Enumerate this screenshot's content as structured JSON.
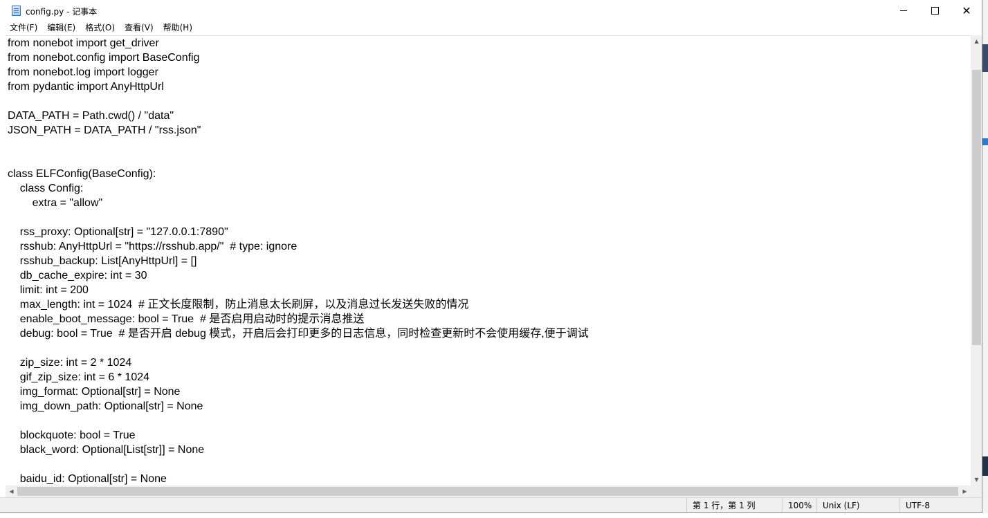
{
  "window": {
    "title": "config.py - 记事本"
  },
  "menu": [
    "文件(F)",
    "编辑(E)",
    "格式(O)",
    "查看(V)",
    "帮助(H)"
  ],
  "editor": {
    "lines": [
      "from nonebot import get_driver",
      "from nonebot.config import BaseConfig",
      "from nonebot.log import logger",
      "from pydantic import AnyHttpUrl",
      "",
      "DATA_PATH = Path.cwd() / \"data\"",
      "JSON_PATH = DATA_PATH / \"rss.json\"",
      "",
      "",
      "class ELFConfig(BaseConfig):",
      "    class Config:",
      "        extra = \"allow\"",
      "",
      "    rss_proxy: Optional[str] = \"127.0.0.1:7890\"",
      "    rsshub: AnyHttpUrl = \"https://rsshub.app/\"  # type: ignore",
      "    rsshub_backup: List[AnyHttpUrl] = []",
      "    db_cache_expire: int = 30",
      "    limit: int = 200",
      "    max_length: int = 1024  # 正文长度限制，防止消息太长刷屏，以及消息过长发送失败的情况",
      "    enable_boot_message: bool = True  # 是否启用启动时的提示消息推送",
      "    debug: bool = True  # 是否开启 debug 模式，开启后会打印更多的日志信息，同时检查更新时不会使用缓存,便于调试",
      "",
      "    zip_size: int = 2 * 1024",
      "    gif_zip_size: int = 6 * 1024",
      "    img_format: Optional[str] = None",
      "    img_down_path: Optional[str] = None",
      "",
      "    blockquote: bool = True",
      "    black_word: Optional[List[str]] = None",
      "",
      "    baidu_id: Optional[str] = None"
    ]
  },
  "status": {
    "position": "第 1 行，第 1 列",
    "zoom": "100%",
    "line_ending": "Unix (LF)",
    "encoding": "UTF-8"
  },
  "icons": {
    "app": "notepad-icon",
    "minimize": "minimize-icon",
    "maximize": "maximize-icon",
    "close": "close-icon"
  }
}
